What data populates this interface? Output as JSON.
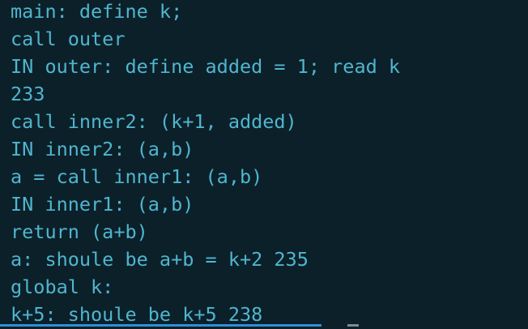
{
  "terminal": {
    "lines": [
      "main: define k;",
      "call outer",
      "IN outer: define added = 1; read k",
      "233",
      "call inner2: (k+1, added)",
      "IN inner2: (a,b)",
      "a = call inner1: (a,b)",
      "IN inner1: (a,b)",
      "return (a+b)",
      "a: shoule be a+b = k+2 235",
      "global k:",
      "k+5: shoule be k+5 238"
    ],
    "colors": {
      "background": "#0c2029",
      "text": "#4fb6cf",
      "scrollbar": "#2f8fd8"
    }
  }
}
